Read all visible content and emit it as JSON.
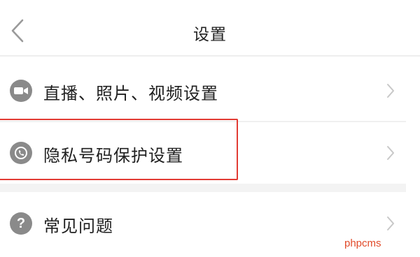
{
  "header": {
    "title": "设置",
    "back_icon": "chevron-left-icon"
  },
  "settings": {
    "items": [
      {
        "label": "直播、照片、视频设置",
        "icon": "video-camera-icon"
      },
      {
        "label": "隐私号码保护设置",
        "icon": "phone-shield-icon"
      },
      {
        "label": "常见问题",
        "icon": "question-icon"
      }
    ]
  },
  "highlight": {
    "color": "#e23b34"
  },
  "watermark": {
    "text": "phpcms"
  },
  "colors": {
    "icon_bg": "#8a8a8a",
    "text": "#1f1f1f",
    "chevron": "#c8c8c8"
  }
}
